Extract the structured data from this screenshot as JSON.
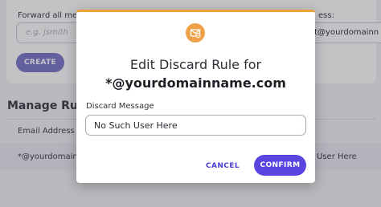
{
  "background": {
    "forward_label": "Forward all mes",
    "forward_label_right": "ess:",
    "username_placeholder": "e.g. jsmith",
    "destination_value": "rt@yourdomainn",
    "create_label": "CREATE",
    "section_heading": "Manage Rule",
    "column_email": "Email Address",
    "row_email": "*@yourdomainn",
    "row_message": "ch User Here"
  },
  "modal": {
    "icon": "mail-icon",
    "accent_color": "#f0a23a",
    "title": "Edit Discard Rule for",
    "domain": "*@yourdomainname.com",
    "field_label": "Discard Message",
    "field_value": "No Such User Here",
    "cancel_label": "CANCEL",
    "confirm_label": "CONFIRM",
    "confirm_color": "#5946e0"
  }
}
